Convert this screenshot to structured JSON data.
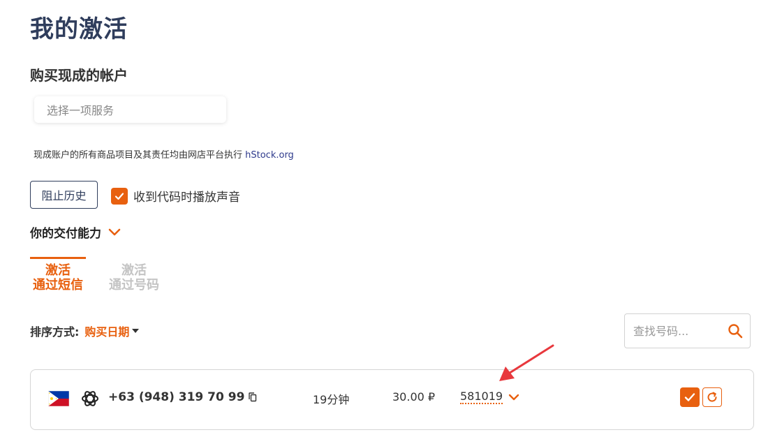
{
  "page": {
    "title": "我的激活",
    "section_title": "购买现成的帐户"
  },
  "service_select": {
    "placeholder": "选择一项服务"
  },
  "note": {
    "text": "现成账户的所有商品项目及其责任均由网店平台执行 ",
    "link_text": "hStock.org"
  },
  "controls": {
    "history_button": "阻止历史",
    "sound_checkbox_label": "收到代码时播放声音",
    "sound_checked": true,
    "capacity_label": "你的交付能力"
  },
  "tabs": [
    {
      "line1": "激活",
      "line2": "通过短信",
      "active": true
    },
    {
      "line1": "激活",
      "line2": "通过号码",
      "active": false
    }
  ],
  "sort": {
    "label": "排序方式:",
    "value": "购买日期"
  },
  "search": {
    "placeholder": "查找号码..."
  },
  "activation": {
    "country_flag": "philippines-flag",
    "service_icon": "openai-icon",
    "phone": "+63 (948) 319 70 99",
    "duration": "19分钟",
    "price": "30.00 ₽",
    "code": "581019"
  },
  "colors": {
    "accent": "#e8600f",
    "title": "#2f3d5c",
    "annotation_arrow": "#e8383d"
  }
}
